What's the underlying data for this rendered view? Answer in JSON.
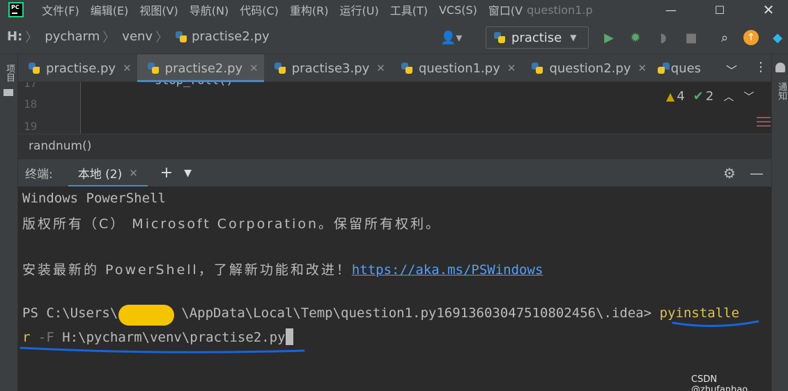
{
  "menu": {
    "items": [
      "文件(F)",
      "编辑(E)",
      "视图(V)",
      "导航(N)",
      "代码(C)",
      "重构(R)",
      "运行(U)",
      "工具(T)",
      "VCS(S)",
      "窗口(V"
    ],
    "window_title": "question1.p",
    "logo_text": "PC"
  },
  "navbar": {
    "crumbs": [
      "H:",
      "pycharm",
      "venv",
      "practise2.py"
    ],
    "run_config": "practise"
  },
  "left_strip_label": "项目",
  "right_strip_label": "通知",
  "tabs": [
    {
      "label": "practise.py",
      "active": false
    },
    {
      "label": "practise2.py",
      "active": true
    },
    {
      "label": "practise3.py",
      "active": false
    },
    {
      "label": "question1.py",
      "active": false
    },
    {
      "label": "question2.py",
      "active": false
    },
    {
      "label": "ques",
      "active": false
    }
  ],
  "editor": {
    "line_numbers": [
      "17",
      "18",
      "19"
    ],
    "code_line": "stop_roll()",
    "warnings": "4",
    "weak_warnings": "2"
  },
  "function_crumb": "randnum()",
  "terminal": {
    "title": "终端:",
    "tab_label": "本地 (2)",
    "line1": "Windows PowerShell",
    "line2": "版权所有（C） Microsoft Corporation。保留所有权利。",
    "line3_prefix": "安装最新的 PowerShell，了解新功能和改进！",
    "line3_link": "https://aka.ms/PSWindows",
    "prompt_prefix": "PS C:\\Users\\",
    "prompt_suffix": "\\AppData\\Local\\Temp\\question1.py16913603047510802456\\.idea>",
    "cmd_part1": "pyinstalle",
    "cmd_part2": "r",
    "flag": "-F",
    "path_arg": "H:\\pycharm\\venv\\practise2.py"
  },
  "watermark": "CSDN @zhufanhao",
  "colors": {
    "annotation_underline": "#1565e0",
    "redaction": "#f5c400",
    "accent": "#4a88c7"
  }
}
